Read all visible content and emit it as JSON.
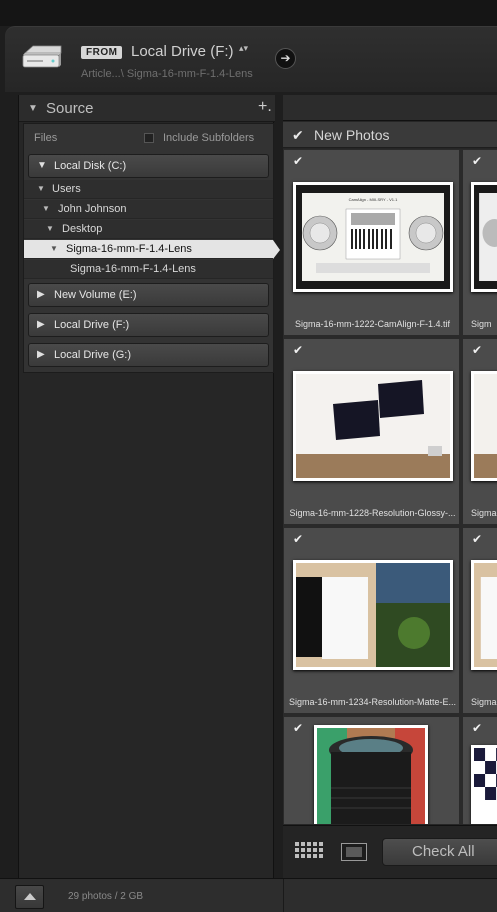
{
  "header": {
    "from_badge": "FROM",
    "from_title": "Local Drive (F:)",
    "from_updown": "▴▾",
    "path": "Article...\\ Sigma-16-mm-F-1.4-Lens",
    "nav_arrow": "➔"
  },
  "source": {
    "title": "Source",
    "add_icon": "+.",
    "files_label": "Files",
    "include_subfolders": "Include Subfolders",
    "include_subfolders_checked": false,
    "volumes": [
      {
        "label": "Local Disk (C:)",
        "expanded": true
      },
      {
        "label": "New Volume (E:)",
        "expanded": false
      },
      {
        "label": "Local Drive (F:)",
        "expanded": false
      },
      {
        "label": "Local Drive (G:)",
        "expanded": false
      }
    ],
    "tree": [
      {
        "label": "Users",
        "depth": 1,
        "expanded": true
      },
      {
        "label": "John Johnson",
        "depth": 2,
        "expanded": true
      },
      {
        "label": "Desktop",
        "depth": 3,
        "expanded": true
      },
      {
        "label": "Sigma-16-mm-F-1.4-Lens",
        "depth": 4,
        "expanded": true,
        "selected": true
      },
      {
        "label": "Sigma-16-mm-F-1.4-Lens",
        "depth": 5,
        "expanded": false
      }
    ]
  },
  "content": {
    "group_label": "New Photos",
    "group_checked": true,
    "photos": [
      {
        "caption": "Sigma-16-mm-1222-CamAlign-F-1.4.tif",
        "checked": true,
        "chart_text": "CamAlign - MIII-SRY - V1.1"
      },
      {
        "caption": "Sigm",
        "checked": true
      },
      {
        "caption": "Sigma-16-mm-1228-Resolution-Glossy-...",
        "checked": true
      },
      {
        "caption": "Sigma-1",
        "checked": true
      },
      {
        "caption": "Sigma-16-mm-1234-Resolution-Matte-E...",
        "checked": true
      },
      {
        "caption": "Sigma-1",
        "checked": true
      },
      {
        "caption": "",
        "checked": true
      },
      {
        "caption": "",
        "checked": true
      }
    ],
    "check_all_label": "Check All"
  },
  "footer": {
    "photo_count": "29 photos / 2 GB"
  },
  "colors": {
    "panel": "#262626",
    "cell": "#4b4b4b",
    "selected_row": "#e4e4e4"
  }
}
